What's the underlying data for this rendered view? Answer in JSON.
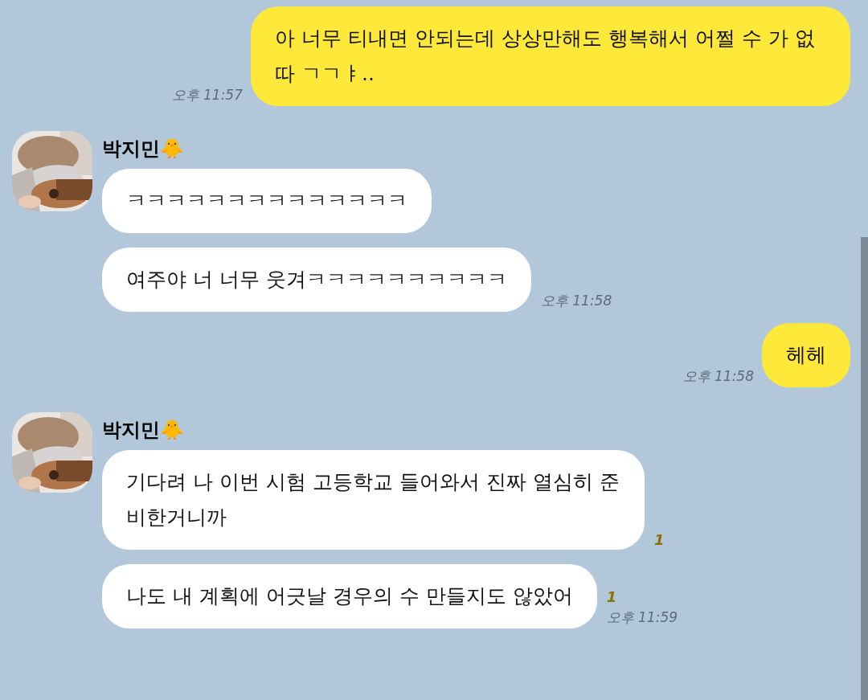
{
  "messages": [
    {
      "kind": "sent",
      "text": "아 너무 티내면 안되는데 상상만해도 행복해서 어쩔 수 가 없따 ㄱㄱㅑ..",
      "time": "오후 11:57"
    },
    {
      "kind": "received",
      "sender": "박지민🐥",
      "bubbles": [
        {
          "text": "ㅋㅋㅋㅋㅋㅋㅋㅋㅋㅋㅋㅋㅋㅋ"
        },
        {
          "text": "여주야 너 너무 웃겨ㅋㅋㅋㅋㅋㅋㅋㅋㅋㅋ",
          "time": "오후 11:58"
        }
      ]
    },
    {
      "kind": "sent",
      "text": "헤헤",
      "time": "오후 11:58"
    },
    {
      "kind": "received",
      "sender": "박지민🐥",
      "bubbles": [
        {
          "text": "기다려 나 이번 시험 고등학교 들어와서 진짜 열심히 준비한거니까",
          "unread": "1"
        },
        {
          "text": "나도 내 계획에 어긋날 경우의 수 만들지도 않았어",
          "unread": "1",
          "time": "오후 11:59"
        }
      ]
    }
  ]
}
